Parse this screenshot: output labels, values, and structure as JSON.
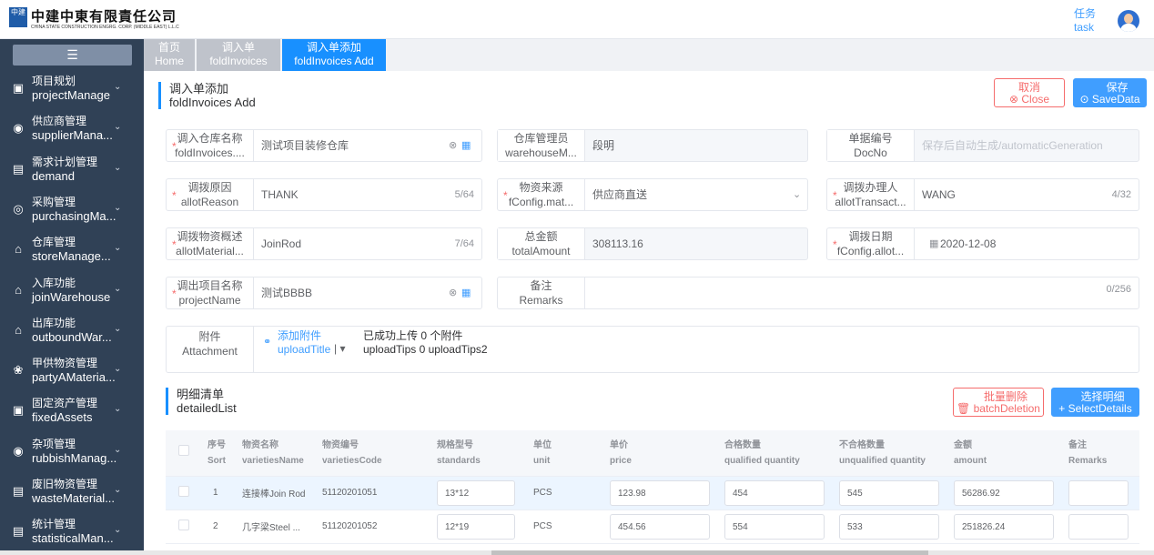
{
  "company": {
    "cn": "中建中東有限責任公司",
    "en": "CHINA STATE CONSTRUCTION ENGRG. CORP. (MIDDLE EAST) L.L.C"
  },
  "logo_text": "中建",
  "header": {
    "task_cn": "任务",
    "task_en": "task"
  },
  "sidebar": {
    "toggle_icon": "☰",
    "items": [
      {
        "cn": "项目规划",
        "en": "projectManage",
        "icon": "▣"
      },
      {
        "cn": "供应商管理",
        "en": "supplierMana...",
        "icon": "◉"
      },
      {
        "cn": "需求计划管理",
        "en": "demand",
        "icon": "▤"
      },
      {
        "cn": "采购管理",
        "en": "purchasingMa...",
        "icon": "◎"
      },
      {
        "cn": "仓库管理",
        "en": "storeManage...",
        "icon": "⌂"
      },
      {
        "cn": "入库功能",
        "en": "joinWarehouse",
        "icon": "⌂"
      },
      {
        "cn": "出库功能",
        "en": "outboundWar...",
        "icon": "⌂"
      },
      {
        "cn": "甲供物资管理",
        "en": "partyAMateria...",
        "icon": "❀"
      },
      {
        "cn": "固定资产管理",
        "en": "fixedAssets",
        "icon": "▣"
      },
      {
        "cn": "杂项管理",
        "en": "rubbishManag...",
        "icon": "◉"
      },
      {
        "cn": "废旧物资管理",
        "en": "wasteMaterial...",
        "icon": "▤"
      },
      {
        "cn": "统计管理",
        "en": "statisticalMan...",
        "icon": "▤"
      }
    ]
  },
  "tabs": [
    {
      "cn": "首页",
      "en": "Home"
    },
    {
      "cn": "调入单",
      "en": "foldInvoices"
    },
    {
      "cn": "调入单添加",
      "en": "foldInvoices Add"
    }
  ],
  "page": {
    "title_cn": "调入单添加",
    "title_en": "foldInvoices Add",
    "close_cn": "取消",
    "close_en": "Close",
    "save_cn": "保存",
    "save_en": "SaveData"
  },
  "form": {
    "warehouse": {
      "cn": "调入仓库名称",
      "en": "foldInvoices....",
      "value": "测试项目装修仓库"
    },
    "keeper": {
      "cn": "仓库管理员",
      "en": "warehouseM...",
      "value": "段明"
    },
    "docno": {
      "cn": "单据编号",
      "en": "DocNo",
      "placeholder": "保存后自动生成/automaticGeneration"
    },
    "reason": {
      "cn": "调拨原因",
      "en": "allotReason",
      "value": "THANK",
      "count": "5/64"
    },
    "source": {
      "cn": "物资来源",
      "en": "fConfig.mat...",
      "value": "供应商直送"
    },
    "handler": {
      "cn": "调拨办理人",
      "en": "allotTransact...",
      "value": "WANG",
      "count": "4/32"
    },
    "summary": {
      "cn": "调拨物资概述",
      "en": "allotMaterial...",
      "value": "JoinRod",
      "count": "7/64"
    },
    "total": {
      "cn": "总金额",
      "en": "totalAmount",
      "value": "308113.16"
    },
    "date": {
      "cn": "调拨日期",
      "en": "fConfig.allot...",
      "value": "2020-12-08"
    },
    "project": {
      "cn": "调出项目名称",
      "en": "projectName",
      "value": "测试BBBB"
    },
    "remarks": {
      "cn": "备注",
      "en": "Remarks",
      "count": "0/256"
    },
    "attach": {
      "cn": "附件",
      "en": "Attachment",
      "add_cn": "添加附件",
      "add_en": "uploadTitle",
      "tip1": "已成功上传 0 个附件",
      "tip2": "uploadTips 0 uploadTips2"
    }
  },
  "detail": {
    "title_cn": "明细清单",
    "title_en": "detailedList",
    "del_cn": "批量删除",
    "del_en": "batchDeletion",
    "sel_cn": "选择明细",
    "sel_en": "SelectDetails"
  },
  "table": {
    "headers": [
      {
        "cn": "序号",
        "en": "Sort"
      },
      {
        "cn": "物资名称",
        "en": "varietiesName"
      },
      {
        "cn": "物资编号",
        "en": "varietiesCode"
      },
      {
        "cn": "规格型号",
        "en": "standards"
      },
      {
        "cn": "单位",
        "en": "unit"
      },
      {
        "cn": "单价",
        "en": "price"
      },
      {
        "cn": "合格数量",
        "en": "qualified quantity"
      },
      {
        "cn": "不合格数量",
        "en": "unqualified quantity"
      },
      {
        "cn": "金额",
        "en": "amount"
      },
      {
        "cn": "备注",
        "en": "Remarks"
      }
    ],
    "rows": [
      {
        "sort": "1",
        "name": "连接棒Join Rod",
        "code": "51120201051",
        "std": "13*12",
        "unit": "PCS",
        "price": "123.98",
        "qq": "454",
        "uq": "545",
        "amount": "56286.92",
        "remark": ""
      },
      {
        "sort": "2",
        "name": "几字梁Steel ...",
        "code": "51120201052",
        "std": "12*19",
        "unit": "PCS",
        "price": "454.56",
        "qq": "554",
        "uq": "533",
        "amount": "251826.24",
        "remark": ""
      }
    ]
  }
}
